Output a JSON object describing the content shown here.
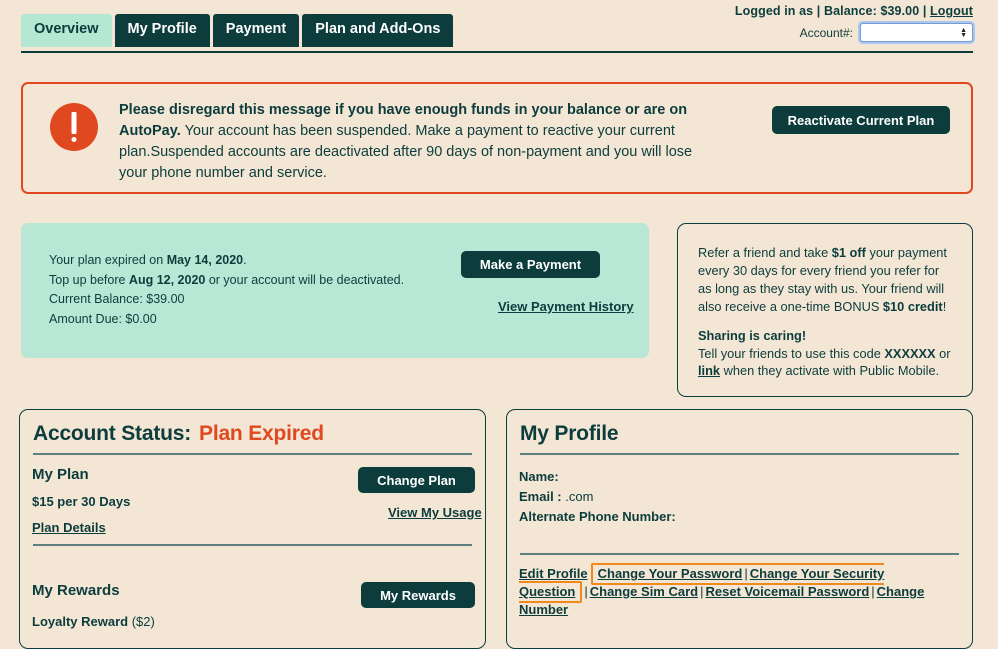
{
  "header": {
    "tabs": [
      {
        "label": "Overview",
        "active": true
      },
      {
        "label": "My Profile",
        "active": false
      },
      {
        "label": "Payment",
        "active": false
      },
      {
        "label": "Plan and Add-Ons",
        "active": false
      }
    ],
    "logged_in_as": "Logged in as",
    "balance_label": "Balance: $39.00",
    "logout_label": "Logout",
    "separator": "|",
    "account_label": "Account#:",
    "account_value": "",
    "account_spinner_icon": "spinner-arrows-icon"
  },
  "alert": {
    "icon": "alert-exclamation-icon",
    "headline": "Please disregard this message if you have enough funds in your balance or are on AutoPay.",
    "body": "Your account has been suspended. Make a payment to reactive your current plan.Suspended accounts are deactivated after 90 days of non-payment and you will lose your phone number and service.",
    "button_label": "Reactivate Current Plan",
    "border_color": "#e0491f",
    "icon_color": "#e0491f"
  },
  "plan_card": {
    "expired_prefix": "Your plan expired on ",
    "expired_date": "May 14, 2020",
    "expired_suffix": ".",
    "topup_prefix": "Top up before ",
    "topup_date": "Aug 12, 2020",
    "topup_suffix": " or your account will be deactivated.",
    "current_balance": "Current Balance: $39.00",
    "amount_due": "Amount Due: $0.00",
    "make_payment_label": "Make a Payment",
    "payment_history_label": "View Payment History",
    "background_color": "#b8e8d5"
  },
  "referral_card": {
    "line_a_1": "Refer a friend and take ",
    "line_a_bold": "$1 off",
    "line_a_2": " your payment every 30 days for every friend you refer for as long as they stay with us. Your friend will also receive a one-time BONUS ",
    "line_a_bold2": "$10 credit",
    "line_a_3": "!",
    "sharing_heading": "Sharing is caring!",
    "line_b_1": "Tell your friends to use this code ",
    "code": "XXXXXX",
    "line_b_2": " or ",
    "link_label": "link",
    "line_b_3": " when they activate with Public Mobile."
  },
  "account_status_card": {
    "title": "Account Status:",
    "status": "Plan Expired",
    "status_color": "#e0491f",
    "my_plan_heading": "My Plan",
    "plan_price": "$15 per 30 Days",
    "plan_details_link": "Plan Details",
    "change_plan_button": "Change Plan",
    "view_usage_link": "View My Usage",
    "my_rewards_heading": "My Rewards",
    "loyalty_reward_label": "Loyalty Reward",
    "loyalty_reward_amount": "($2)",
    "my_rewards_button": "My Rewards"
  },
  "profile_card": {
    "title": "My Profile",
    "name_label": "Name:",
    "name_value": "",
    "email_label": "Email :",
    "email_value": ".com",
    "alt_phone_label": "Alternate Phone Number:",
    "alt_phone_value": "",
    "links": {
      "edit_profile": "Edit Profile",
      "change_password": "Change Your Password",
      "change_security_question": "Change Your Security Question",
      "change_sim_card": "Change Sim Card",
      "reset_voicemail_password": "Reset Voicemail Password",
      "change_number": "Change Number",
      "separator": "|"
    },
    "highlight_color": "#f08a1e"
  }
}
